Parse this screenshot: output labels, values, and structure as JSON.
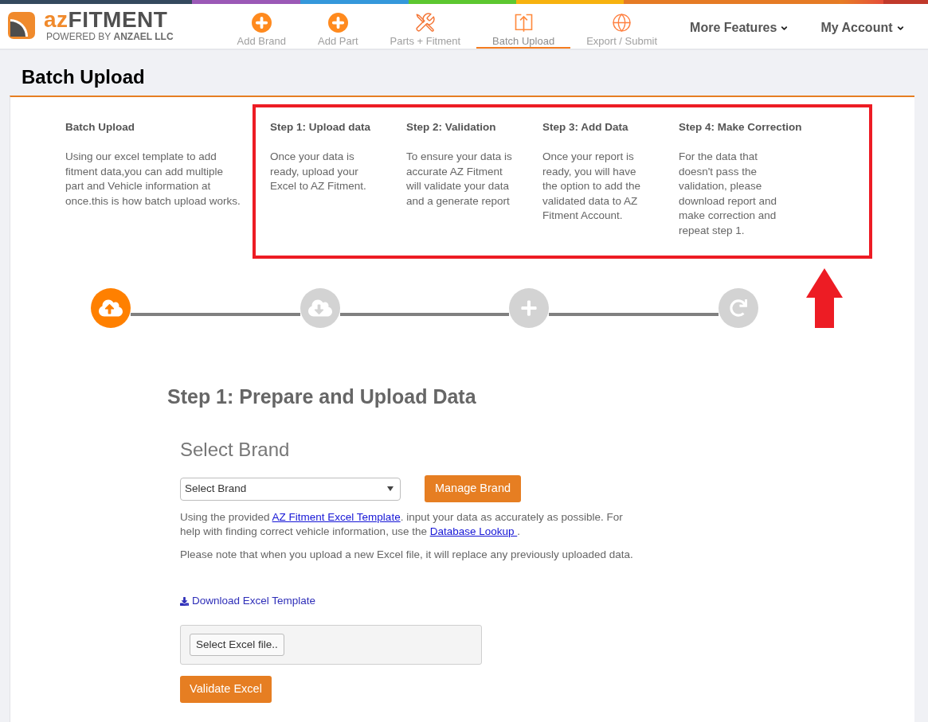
{
  "header": {
    "logo": {
      "wordmark_accent": "az",
      "wordmark_rest": "FITMENT",
      "tagline": "POWERED BY **ANZAEL LLC**"
    },
    "nav": [
      {
        "label": "Add Brand",
        "selected": false
      },
      {
        "label": "Add Part",
        "selected": false
      },
      {
        "label": "Parts + Fitment",
        "selected": false
      },
      {
        "label": "Batch Upload",
        "selected": true
      },
      {
        "label": "Export / Submit",
        "selected": false
      }
    ],
    "menus": [
      {
        "label": "More Features"
      },
      {
        "label": "My Account"
      }
    ]
  },
  "page": {
    "title": "Batch Upload"
  },
  "intro": {
    "title": "Batch Upload",
    "text": "Using our excel template to add fitment data,you can add multiple part and Vehicle information at once.this is how batch upload works."
  },
  "steps": [
    {
      "title": "Step 1: Upload data",
      "text": "Once your data is ready, upload your Excel to AZ Fitment."
    },
    {
      "title": "Step 2: Validation",
      "text": "To ensure your data is accurate AZ Fitment will validate your data and a generate report"
    },
    {
      "title": "Step 3: Add Data",
      "text": "Once your report is ready, you will have the option to add the validated data to AZ Fitment Account."
    },
    {
      "title": "Step 4: Make Correction",
      "text": "For the data that doesn't pass the validation, please download report and make correction and repeat step 1."
    }
  ],
  "progress": [
    {
      "active": true
    },
    {
      "active": false
    },
    {
      "active": false
    },
    {
      "active": false
    }
  ],
  "form": {
    "heading": "Step 1: Prepare and Upload Data",
    "brand_section": {
      "title": "Select Brand",
      "select": {
        "value": "Select Brand"
      },
      "button": "Manage Brand"
    },
    "help_text": [
      {
        "kind": "text",
        "text": "Using the provided "
      },
      {
        "kind": "link",
        "text": "AZ Fitment Excel Template"
      },
      {
        "kind": "text",
        "text": ". input your data as accurately as possible. For help with finding correct vehicle information, use the "
      },
      {
        "kind": "link",
        "text": "Database Lookup "
      },
      {
        "kind": "text",
        "text": "."
      }
    ],
    "note": "Please note that when you upload a new Excel file, it will replace any previously uploaded data.",
    "download_link": "Download Excel Template",
    "file_picker": {
      "button": "Select Excel file.."
    },
    "validate_button": "Validate Excel"
  }
}
